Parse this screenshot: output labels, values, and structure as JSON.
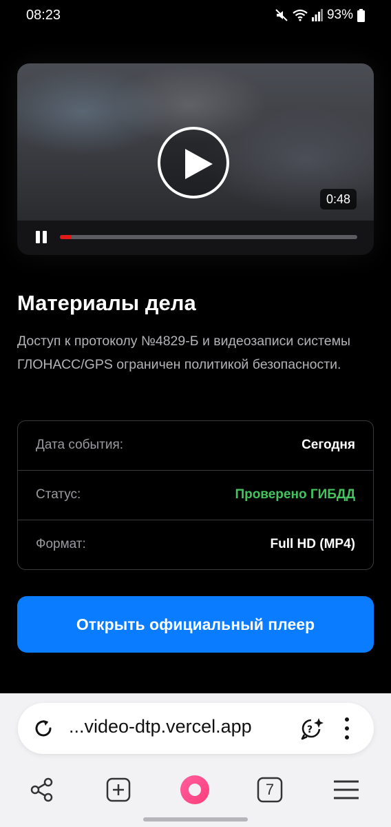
{
  "status_bar": {
    "time": "08:23",
    "battery": "93%",
    "icons": [
      "mute-icon",
      "wifi-icon",
      "signal-icon",
      "battery-icon"
    ]
  },
  "video": {
    "duration": "0:48",
    "progress": 0.04,
    "icons": [
      "play-icon",
      "pause-icon"
    ]
  },
  "case": {
    "title": "Материалы дела",
    "description": "Доступ к протоколу №4829-Б и видеозаписи системы ГЛОНАСС/GPS ограничен политикой безопасности."
  },
  "details": [
    {
      "label": "Дата события:",
      "value": "Сегодня",
      "color": "#ffffff"
    },
    {
      "label": "Статус:",
      "value": "Проверено ГИБДД",
      "color": "#45c35e"
    },
    {
      "label": "Формат:",
      "value": "Full HD (MP4)",
      "color": "#ffffff"
    }
  ],
  "open_button": {
    "label": "Открыть официальный плеер",
    "color": "#0a7cff"
  },
  "browser": {
    "url": "...video-dtp.vercel.app",
    "tabs_count": "7",
    "nav_icons": [
      "share-icon",
      "new-tab-icon",
      "alice-icon",
      "tabs-icon",
      "menu-icon"
    ]
  }
}
